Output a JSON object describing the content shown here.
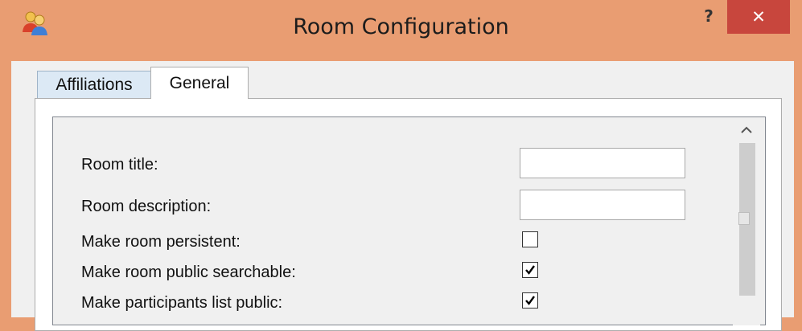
{
  "window": {
    "title": "Room Configuration",
    "help_label": "?",
    "close_label": "✕",
    "app_icon": "group-chat-icon"
  },
  "tabs": [
    {
      "label": "Affiliations",
      "active": false
    },
    {
      "label": "General",
      "active": true
    }
  ],
  "form": {
    "room_title": {
      "label": "Room title:",
      "value": ""
    },
    "room_description": {
      "label": "Room description:",
      "value": ""
    },
    "persistent": {
      "label": "Make room persistent:",
      "checked": false
    },
    "public_searchable": {
      "label": "Make room public searchable:",
      "checked": true
    },
    "participants_public": {
      "label": "Make participants list public:",
      "checked": true
    }
  },
  "colors": {
    "titlebar": "#e99d72",
    "close_button": "#c8463d",
    "tab_inactive": "#dce9f5"
  }
}
